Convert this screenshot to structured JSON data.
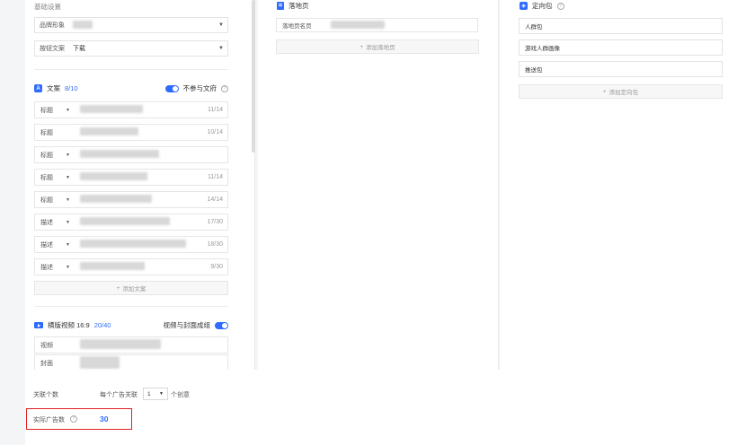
{
  "basic": {
    "title": "基础设置",
    "fields": [
      {
        "label": "品牌形象",
        "value": ""
      },
      {
        "label": "按钮文案",
        "value": "下载"
      }
    ]
  },
  "copy": {
    "icon": "A",
    "title": "文案",
    "count": "8/10",
    "toggle_label": "不参与文府",
    "rows": [
      {
        "type": "标题",
        "count": "11/14"
      },
      {
        "type": "标题",
        "count": "10/14"
      },
      {
        "type": "标题",
        "count": ""
      },
      {
        "type": "标题",
        "count": "11/14"
      },
      {
        "type": "标题",
        "count": "14/14"
      },
      {
        "type": "描述",
        "count": "17/30"
      },
      {
        "type": "描述",
        "count": "18/30"
      },
      {
        "type": "描述",
        "count": "9/30"
      }
    ],
    "add_label": "添加文案"
  },
  "video": {
    "title": "横版视频 16:9",
    "count": "20/40",
    "toggle_label": "视频与封面成组",
    "rows": [
      {
        "type": "视频"
      },
      {
        "type": "封面"
      }
    ]
  },
  "landing": {
    "title": "落地页",
    "row_label": "落地页名页",
    "add_label": "添加落地页"
  },
  "targeting": {
    "title": "定向包",
    "items": [
      "人群包",
      "游戏人群画像",
      "推送包"
    ],
    "add_label": "添加定向包"
  },
  "bottom": {
    "association_label": "关联个数",
    "per_ad_prefix": "每个广告关联",
    "per_ad_value": "1",
    "per_ad_suffix": "个创意",
    "actual_label": "实际广告数",
    "actual_value": "30"
  },
  "colors": {
    "accent": "#2f6bff",
    "highlight": "#e02020"
  }
}
